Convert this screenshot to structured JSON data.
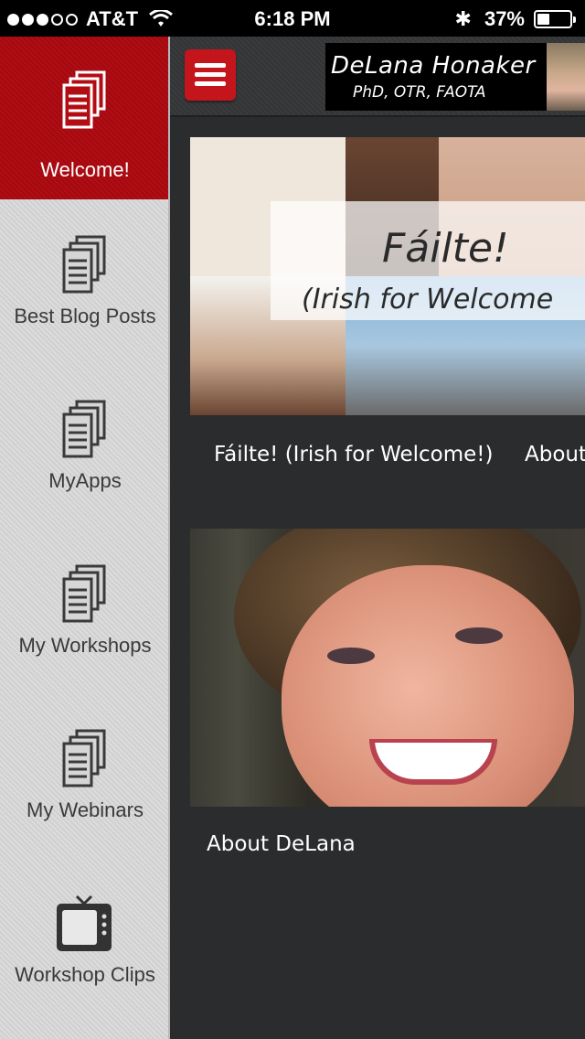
{
  "status": {
    "carrier": "AT&T",
    "time": "6:18 PM",
    "battery": "37%",
    "battery_level": 0.37,
    "signal_bars_filled": 3,
    "signal_bars_total": 5
  },
  "sidebar": {
    "items": [
      {
        "label": "Welcome!",
        "icon": "document-stack-icon",
        "active": true
      },
      {
        "label": "Best Blog Posts",
        "icon": "document-stack-icon",
        "active": false
      },
      {
        "label": "MyApps",
        "icon": "document-stack-icon",
        "active": false
      },
      {
        "label": "My Workshops",
        "icon": "document-stack-icon",
        "active": false
      },
      {
        "label": "My Webinars",
        "icon": "document-stack-icon",
        "active": false
      },
      {
        "label": "Workshop Clips",
        "icon": "tv-icon",
        "active": false
      }
    ]
  },
  "header": {
    "name": "DeLana Honaker",
    "credentials": "PhD, OTR, FAOTA"
  },
  "cards": [
    {
      "banner_title": "Fáilte!",
      "banner_subtitle": "(Irish for Welcome",
      "caption": "Fáilte! (Irish for Welcome!)",
      "next_caption": "About"
    },
    {
      "caption": "About DeLana"
    }
  ],
  "colors": {
    "accent_red": "#c4151c",
    "sidebar_bg": "#d6d6d6",
    "main_bg": "#2b2c2e"
  }
}
